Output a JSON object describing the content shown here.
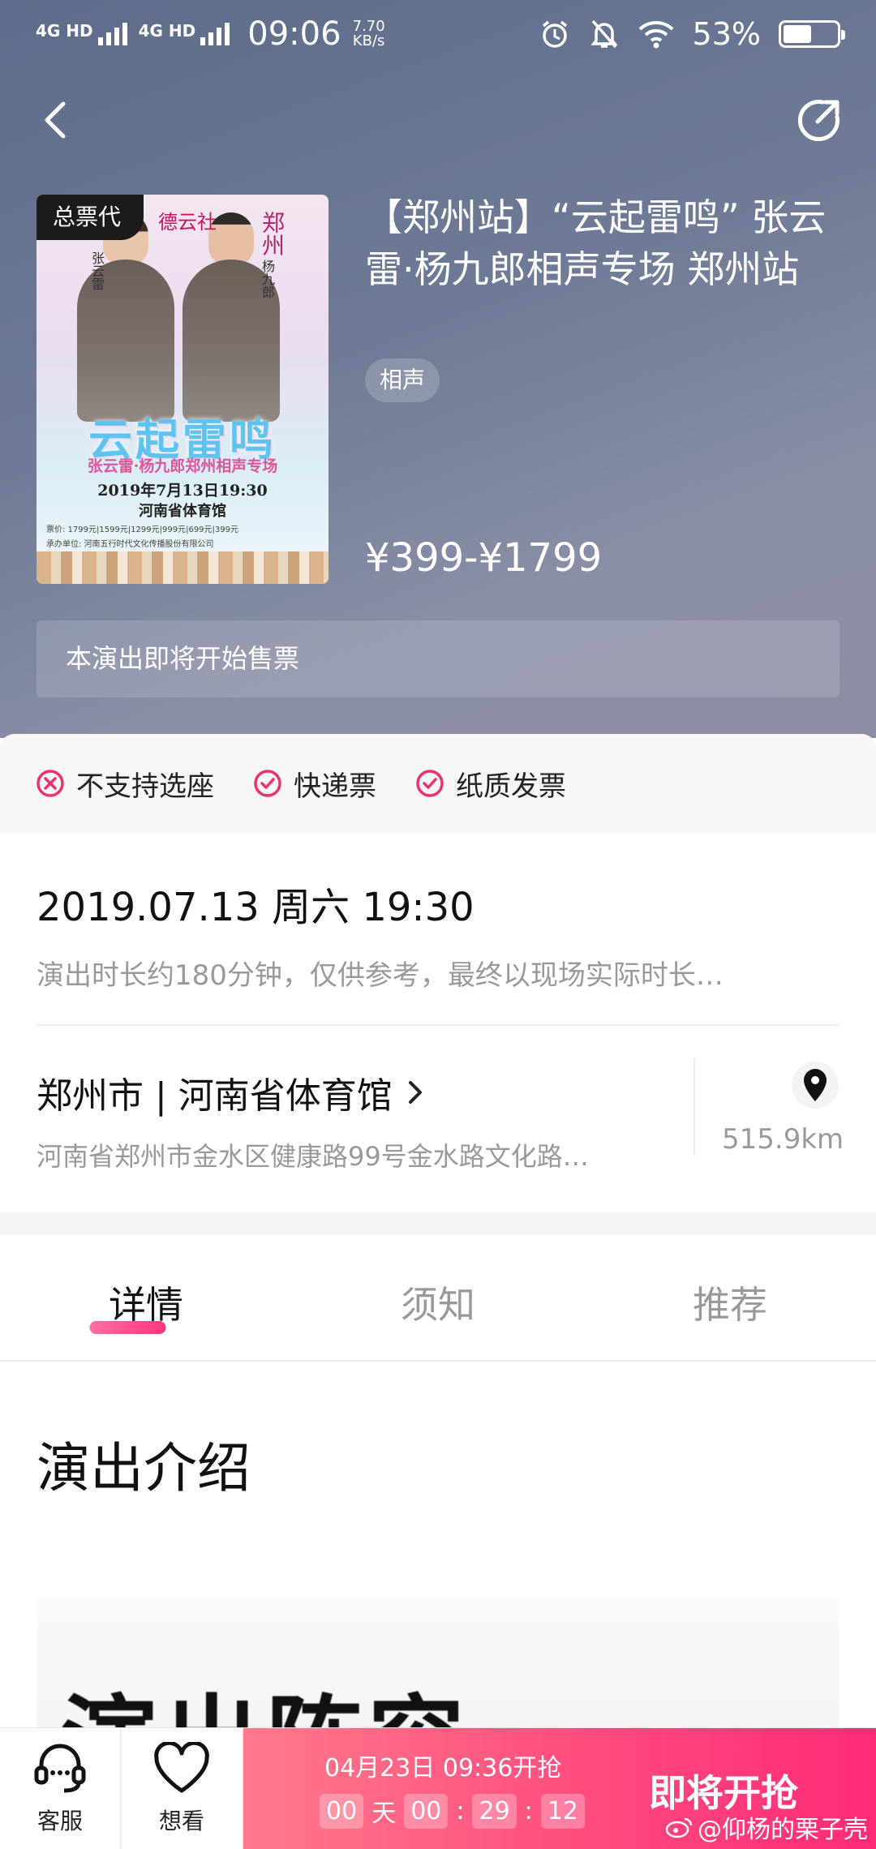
{
  "status_bar": {
    "network_1": "4G HD",
    "network_2": "4G HD",
    "time": "09:06",
    "speed_value": "7.70",
    "speed_unit": "KB/s",
    "battery": "53%",
    "battery_level": 0.53
  },
  "poster": {
    "badge": "总票代",
    "logo_text": "德云社",
    "city": "郑州",
    "name_left": "张云雷",
    "name_right": "杨九郎",
    "title": "云起雷鸣",
    "subtitle": "张云雷·杨九郎郑州相声专场",
    "date": "2019年7月13日19:30",
    "venue": "河南省体育馆",
    "prices": "票价: 1799元|1599元|1299元|999元|699元|399元",
    "organizer": "承办单位: 河南五行时代文化传播股份有限公司"
  },
  "show": {
    "title": "【郑州站】“云起雷鸣” 张云雷·杨九郎相声专场 郑州站",
    "tag": "相声",
    "price": "¥399-¥1799",
    "notice": "本演出即将开始售票"
  },
  "features": [
    {
      "label": "不支持选座",
      "icon": "circle-x-icon",
      "color": "#e8336f"
    },
    {
      "label": "快递票",
      "icon": "circle-check-icon",
      "color": "#e8336f"
    },
    {
      "label": "纸质发票",
      "icon": "circle-check-icon",
      "color": "#e8336f"
    }
  ],
  "schedule": {
    "datetime": "2019.07.13 周六 19:30",
    "duration_note": "演出时长约180分钟，仅供参考，最终以现场实际时长…"
  },
  "venue": {
    "name": "郑州市 | 河南省体育馆",
    "address": "河南省郑州市金水区健康路99号金水路文化路…",
    "distance": "515.9km"
  },
  "tabs": [
    {
      "label": "详情",
      "active": true
    },
    {
      "label": "须知",
      "active": false
    },
    {
      "label": "推荐",
      "active": false
    }
  ],
  "content": {
    "section_title": "演出介绍",
    "lineup_heading": "演出阵容"
  },
  "bottom_bar": {
    "service_label": "客服",
    "wish_label": "想看",
    "sale_time": "04月23日 09:36开抢",
    "countdown": {
      "days": "00",
      "day_unit": "天",
      "hours": "00",
      "minutes": "29",
      "seconds": "12",
      "separator": ":"
    },
    "buy_label": "即将开抢",
    "watermark": "@仰杨的栗子壳"
  },
  "colors": {
    "accent": "#ff2a78",
    "hero_bg": "#6f7b96",
    "icon_pink": "#e8336f"
  }
}
